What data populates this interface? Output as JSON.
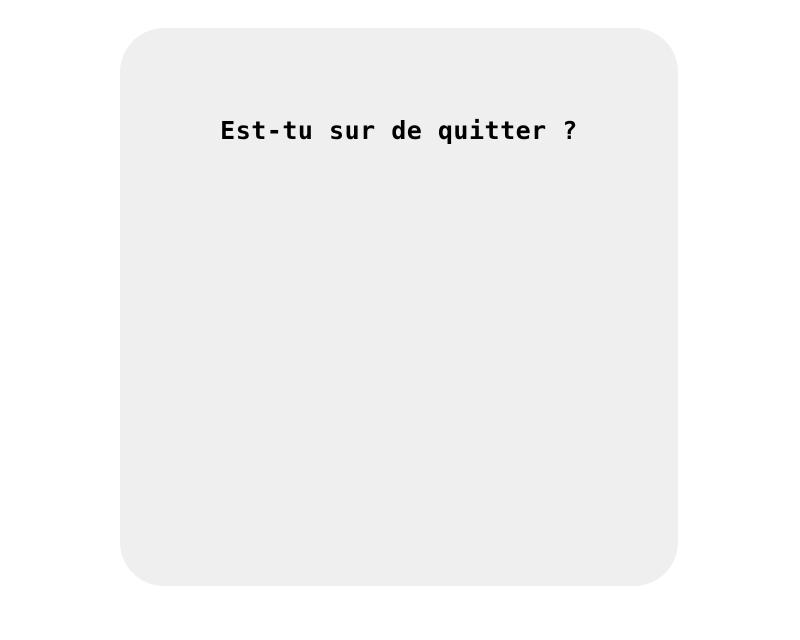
{
  "dialog": {
    "title": "Est-tu sur de quitter ?",
    "background_color": "#efefef",
    "text_color": "#000000"
  }
}
